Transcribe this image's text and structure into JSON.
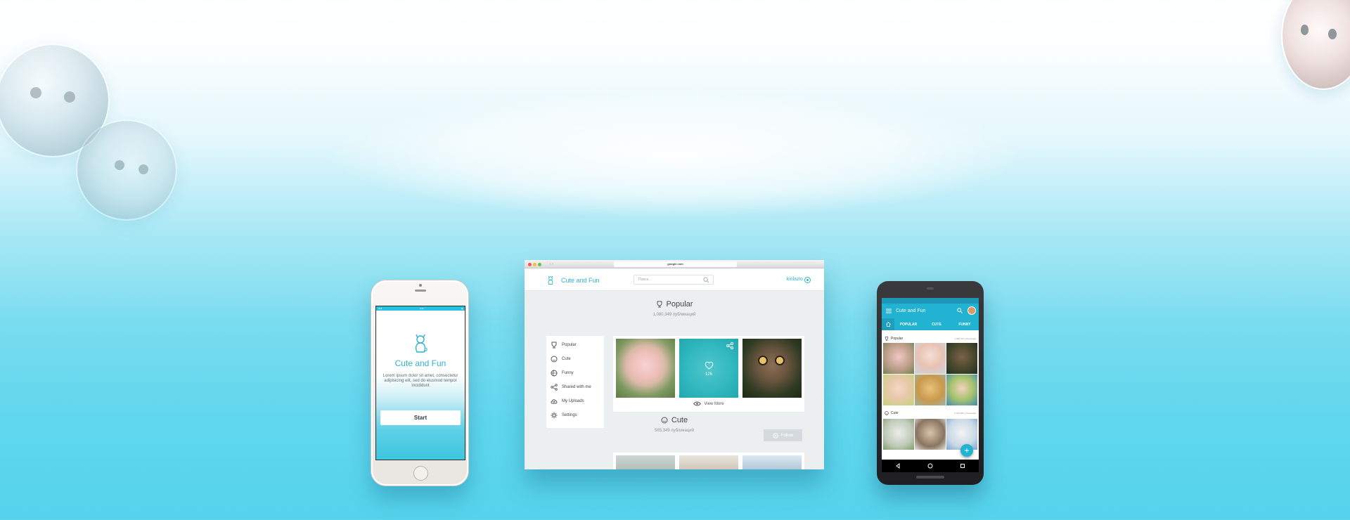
{
  "iphone": {
    "app_title": "Cute and Fun",
    "intro_text": "Lorem ipsum dolor sit amet, consectetur adipisicing elit, sed do eiusmod tempor incididunt",
    "start_label": "Start"
  },
  "browser": {
    "url": "google.com",
    "app_title": "Cute and Fun",
    "search_placeholder": "Поиск...",
    "username": "kirilazio",
    "sidebar": [
      {
        "label": "Popular",
        "icon": "trophy-icon"
      },
      {
        "label": "Cute",
        "icon": "smile-icon"
      },
      {
        "label": "Funny",
        "icon": "ball-icon"
      },
      {
        "label": "Shared with me",
        "icon": "share-icon"
      },
      {
        "label": "My Uploads",
        "icon": "cloud-upload-icon"
      },
      {
        "label": "Settings",
        "icon": "gear-icon"
      }
    ],
    "popular": {
      "title": "Popular",
      "count": "1,080,349 публикаций"
    },
    "like_count": "126",
    "view_more": "View More",
    "cute": {
      "title": "Cute",
      "count": "565,349 публикаций"
    },
    "follow_label": "Follow"
  },
  "android": {
    "app_title": "Cute and Fun",
    "tabs": [
      "POPULAR",
      "CUTE",
      "FUNNY"
    ],
    "popular": {
      "title": "Popular",
      "count": "1,085,349 публикаций"
    },
    "cute": {
      "title": "Cute",
      "count": "6,540,080 публикаций"
    }
  },
  "colors": {
    "accent": "#2fb3d1",
    "android_bar": "#22b2d2"
  }
}
